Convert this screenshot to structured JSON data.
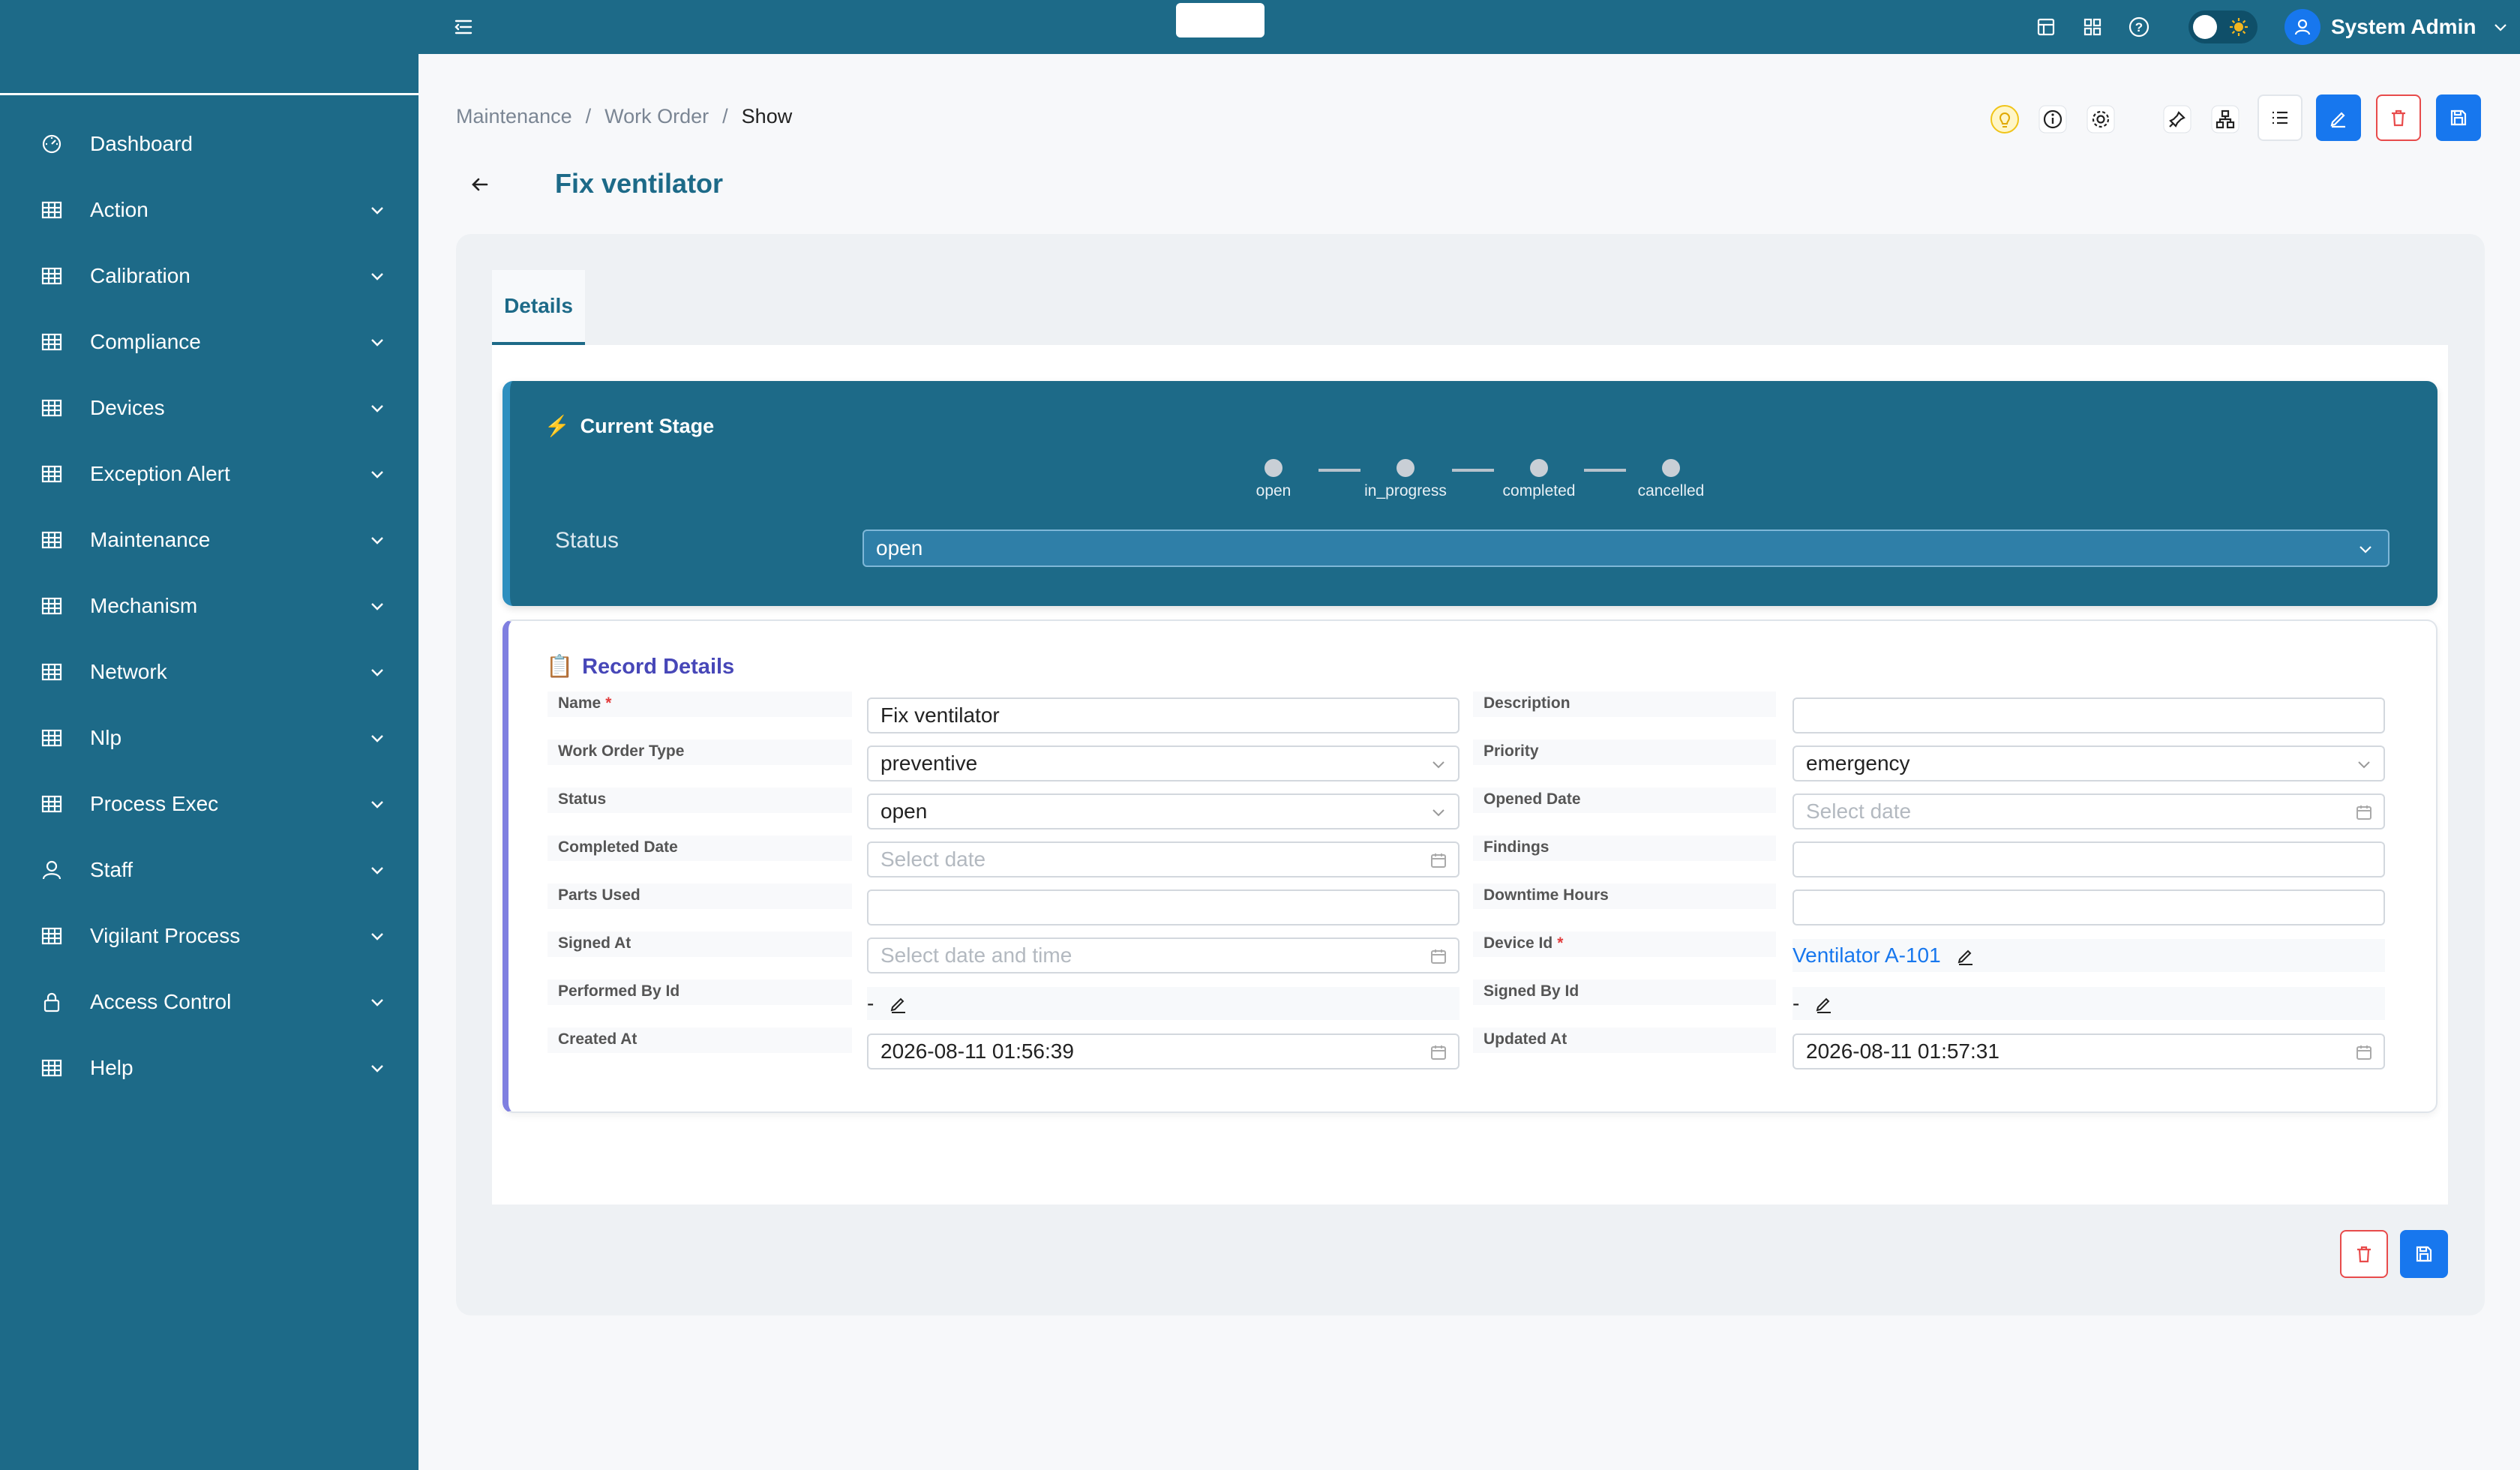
{
  "sidebar": {
    "items": [
      {
        "label": "Dashboard",
        "icon": "dashboard-gauge-icon",
        "expandable": false
      },
      {
        "label": "Action",
        "icon": "table-grid-icon",
        "expandable": true
      },
      {
        "label": "Calibration",
        "icon": "table-grid-icon",
        "expandable": true
      },
      {
        "label": "Compliance",
        "icon": "table-grid-icon",
        "expandable": true
      },
      {
        "label": "Devices",
        "icon": "table-grid-icon",
        "expandable": true
      },
      {
        "label": "Exception Alert",
        "icon": "table-grid-icon",
        "expandable": true
      },
      {
        "label": "Maintenance",
        "icon": "table-grid-icon",
        "expandable": true
      },
      {
        "label": "Mechanism",
        "icon": "table-grid-icon",
        "expandable": true
      },
      {
        "label": "Network",
        "icon": "table-grid-icon",
        "expandable": true
      },
      {
        "label": "Nlp",
        "icon": "table-grid-icon",
        "expandable": true
      },
      {
        "label": "Process Exec",
        "icon": "table-grid-icon",
        "expandable": true
      },
      {
        "label": "Staff",
        "icon": "user-icon",
        "expandable": true
      },
      {
        "label": "Vigilant Process",
        "icon": "table-grid-icon",
        "expandable": true
      },
      {
        "label": "Access Control",
        "icon": "lock-icon",
        "expandable": true
      },
      {
        "label": "Help",
        "icon": "table-grid-icon",
        "expandable": true
      }
    ]
  },
  "topbar": {
    "user_name": "System Admin",
    "theme_toggle": "light"
  },
  "breadcrumb": {
    "items": [
      "Maintenance",
      "Work Order",
      "Show"
    ],
    "separator": "/"
  },
  "page": {
    "title": "Fix ventilator"
  },
  "tabs": [
    {
      "label": "Details",
      "active": true
    }
  ],
  "stage": {
    "title": "Current Stage",
    "icon": "⚡",
    "steps": [
      "open",
      "in_progress",
      "completed",
      "cancelled"
    ],
    "status_label": "Status",
    "status_value": "open"
  },
  "record": {
    "title": "Record Details",
    "icon": "📋",
    "fields": {
      "name": {
        "label": "Name",
        "value": "Fix ventilator",
        "required": true
      },
      "description": {
        "label": "Description",
        "value": ""
      },
      "work_order_type": {
        "label": "Work Order Type",
        "value": "preventive"
      },
      "priority": {
        "label": "Priority",
        "value": "emergency"
      },
      "status": {
        "label": "Status",
        "value": "open"
      },
      "opened_date": {
        "label": "Opened Date",
        "placeholder": "Select date"
      },
      "completed_date": {
        "label": "Completed Date",
        "placeholder": "Select date"
      },
      "findings": {
        "label": "Findings",
        "value": ""
      },
      "parts_used": {
        "label": "Parts Used",
        "value": ""
      },
      "downtime_hours": {
        "label": "Downtime Hours",
        "value": ""
      },
      "signed_at": {
        "label": "Signed At",
        "placeholder": "Select date and time"
      },
      "device_id": {
        "label": "Device Id",
        "value": "Ventilator A-101",
        "required": true
      },
      "performed_by_id": {
        "label": "Performed By Id",
        "value": "-"
      },
      "signed_by_id": {
        "label": "Signed By Id",
        "value": "-"
      },
      "created_at": {
        "label": "Created At",
        "value": "2026-08-11 01:56:39"
      },
      "updated_at": {
        "label": "Updated At",
        "value": "2026-08-11 01:57:31"
      }
    }
  },
  "colors": {
    "primary": "#1d6a88",
    "accent_blue": "#1777ee",
    "danger": "#e84b4b",
    "record_accent": "#7f7fe0"
  }
}
